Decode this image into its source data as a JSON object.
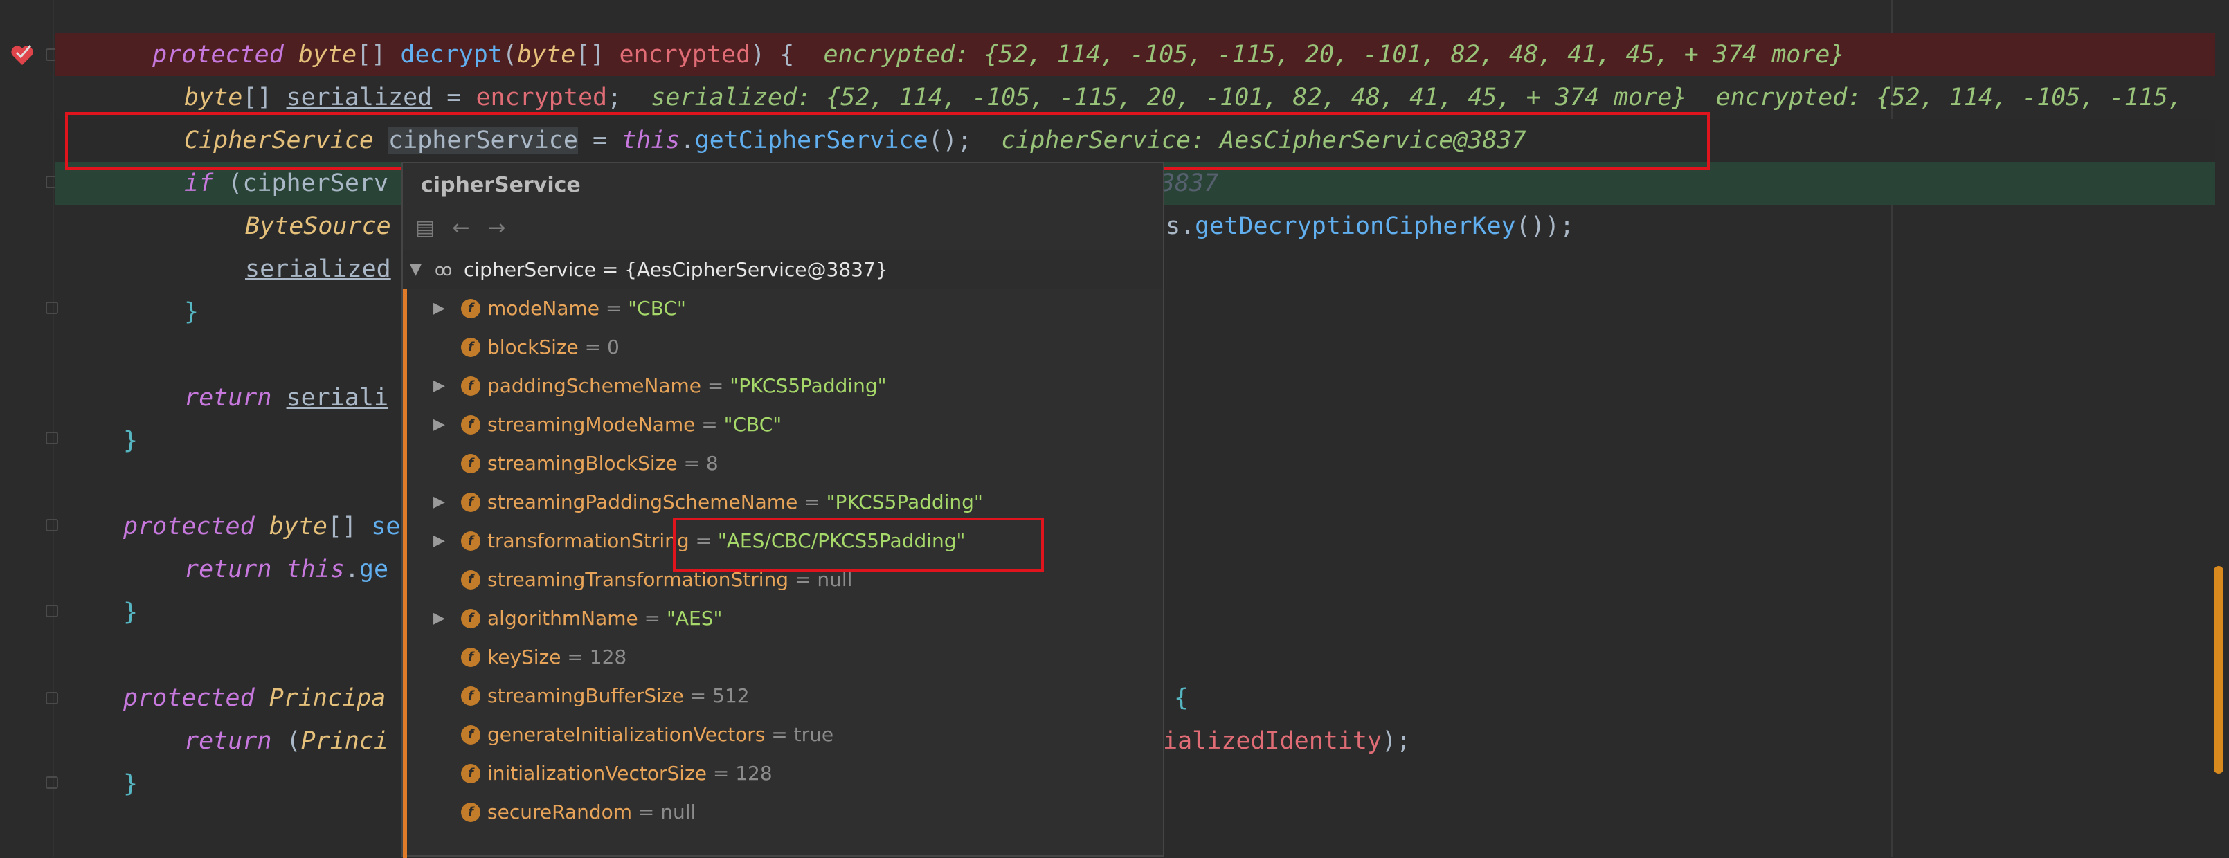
{
  "editor": {
    "lines": [
      {
        "kw1": "protected ",
        "ty1": "byte",
        "p1": "[] ",
        "fn": "decrypt",
        "p2": "(",
        "ty2": "byte",
        "p3": "[] ",
        "vr": "encrypted",
        "p4": ") {",
        "hint": "encrypted: {52, 114, -105, -115, 20, -101, 82, 48, 41, 45, + 374 more}"
      },
      {
        "ty": "byte",
        "p1": "[] ",
        "ul": "serialized",
        "p2": " = ",
        "vr": "encrypted",
        "p3": ";",
        "hint1": "serialized: {52, 114, -105, -115, 20, -101, 82, 48, 41, 45, + 374 more}",
        "hint2": "encrypted: {52, 114, -105, -115,"
      },
      {
        "ty": "CipherService",
        "p1": " ",
        "hl": "cipherService",
        "p2": " = ",
        "kw": "this",
        "p3": ".",
        "fn": "getCipherService",
        "p4": "();",
        "hint": "cipherService: AesCipherService@3837"
      },
      {
        "kw": "if",
        "p1": " (",
        "p2": "cipherServ",
        "tail": "3837"
      },
      {
        "ty": "ByteSource",
        "tail_a": "s.",
        "fn": "getDecryptionCipherKey",
        "tail_b": "());"
      },
      {
        "ul": "serialized"
      },
      {
        "pu": "}"
      },
      {
        "kw": "return",
        "ul": "seriali"
      },
      {
        "pu": "}"
      },
      {
        "kw1": "protected ",
        "ty": "byte",
        "p1": "[] ",
        "frag": "se"
      },
      {
        "kw": "return",
        "p1": " ",
        "kw2": "this",
        "p2": ".",
        "frag": "ge"
      },
      {
        "pu": "}"
      },
      {
        "kw": "protected ",
        "ty": "Principa",
        "tail": "{"
      },
      {
        "kw": "return",
        "p1": " (",
        "ty": "Princi",
        "vr": "ializedIdentity",
        "p2": ");"
      },
      {
        "pu": "}"
      }
    ]
  },
  "popup": {
    "title": "cipherService",
    "root": "cipherService = {AesCipherService@3837}",
    "fields": [
      {
        "name": "modeName",
        "value": "\"CBC\"",
        "kind": "str",
        "expandable": true
      },
      {
        "name": "blockSize",
        "value": "0",
        "kind": "num",
        "expandable": false
      },
      {
        "name": "paddingSchemeName",
        "value": "\"PKCS5Padding\"",
        "kind": "str",
        "expandable": true
      },
      {
        "name": "streamingModeName",
        "value": "\"CBC\"",
        "kind": "str",
        "expandable": true
      },
      {
        "name": "streamingBlockSize",
        "value": "8",
        "kind": "num",
        "expandable": false
      },
      {
        "name": "streamingPaddingSchemeName",
        "value": "\"PKCS5Padding\"",
        "kind": "str",
        "expandable": true
      },
      {
        "name": "transformationString",
        "value": "\"AES/CBC/PKCS5Padding\"",
        "kind": "str",
        "expandable": true
      },
      {
        "name": "streamingTransformationString",
        "value": "null",
        "kind": "num",
        "expandable": false
      },
      {
        "name": "algorithmName",
        "value": "\"AES\"",
        "kind": "str",
        "expandable": true
      },
      {
        "name": "keySize",
        "value": "128",
        "kind": "num",
        "expandable": false
      },
      {
        "name": "streamingBufferSize",
        "value": "512",
        "kind": "num",
        "expandable": false
      },
      {
        "name": "generateInitializationVectors",
        "value": "true",
        "kind": "num",
        "expandable": false
      },
      {
        "name": "initializationVectorSize",
        "value": "128",
        "kind": "num",
        "expandable": false
      },
      {
        "name": "secureRandom",
        "value": "null",
        "kind": "num",
        "expandable": false
      }
    ],
    "eq": " = ",
    "field_icon": "f",
    "expand_glyph": "▶",
    "collapse_glyph": "▼",
    "glasses_glyph": "oo",
    "back_glyph": "←",
    "forward_glyph": "→",
    "folder_glyph": "▤"
  }
}
